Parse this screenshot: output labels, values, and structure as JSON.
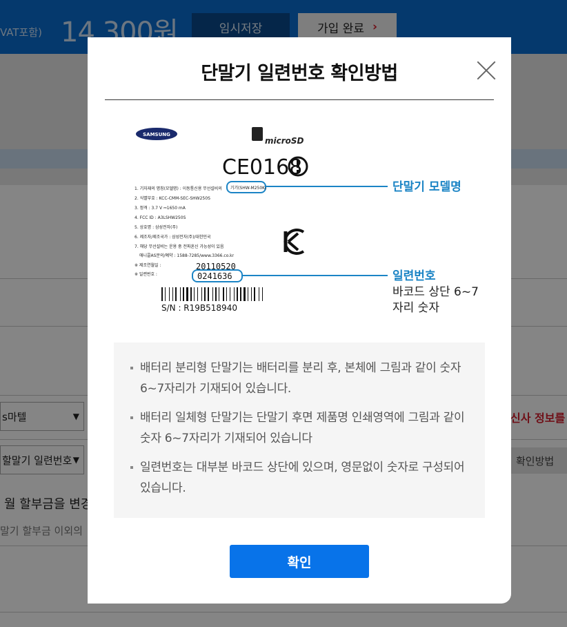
{
  "header": {
    "vat_label": "VAT포함)",
    "price": "14,300원",
    "temp_save_label": "임시저장",
    "join_complete_label": "가입 완료",
    "join_chevron": "›"
  },
  "background": {
    "select_plan": "s마텔",
    "select_serial": "할말기 일련번호",
    "carrier_info": "신사 정보를",
    "howto_label": "확인방법",
    "text_change": "월 할부금을 변경",
    "text_other": "말기 할부금 이외의"
  },
  "modal": {
    "title": "단말기 일련번호 확인방법",
    "illustration": {
      "brand": "SAMSUNG",
      "micro_sd": "microSD",
      "ce_mark": "CE0168",
      "spec_lines": [
        "1. 기자재의 명칭(모델명) : 이동통신용 무선설비의",
        "2. 식별부호 : KCC-CMM-SEC-SHW250S",
        "3. 정격 : 3.7 V ⎓1650 mA",
        "4. FCC ID : A3LSHW250S",
        "5. 상호명 : 삼성전자(주)",
        "6. 제조자/제조국가 : 삼성전자(주)/대한민국",
        "7. 해당 무선설비는 운용 중 전파혼신 가능성이 있음",
        "애니콜AS문의/예약 : 1588-7285/www.3366.co.kr",
        "※ 제조연월일 :",
        "※ 일련번호 :"
      ],
      "model_box": "기기(SHW-M250K)",
      "date_value": "20110520",
      "serial_value": "0241636",
      "sn_line": "S/N : R19B518940",
      "callout_model": "단말기 모델명",
      "callout_serial": "일련번호",
      "callout_serial_sub1": "바코드 상단 6~7",
      "callout_serial_sub2": "자리 숫자"
    },
    "info_items": [
      "배터리 분리형 단말기는 배터리를 분리 후, 본체에 그림과 같이 숫자 6~7자리가 기재되어 있습니다.",
      "배터리 일체형 단말기는 단말기 후면 제품명 인쇄영역에 그림과 같이 숫자 6~7자리가 기재되어 있습니다",
      "일련번호는 대부분 바코드 상단에 있으며, 영문없이 숫자로 구성되어 있습니다."
    ],
    "confirm_label": "확인"
  },
  "colors": {
    "header_blue": "#0a6ed1",
    "confirm_blue": "#0873e9",
    "callout_blue": "#1b84c5",
    "carrier_red": "#d51e2c"
  }
}
